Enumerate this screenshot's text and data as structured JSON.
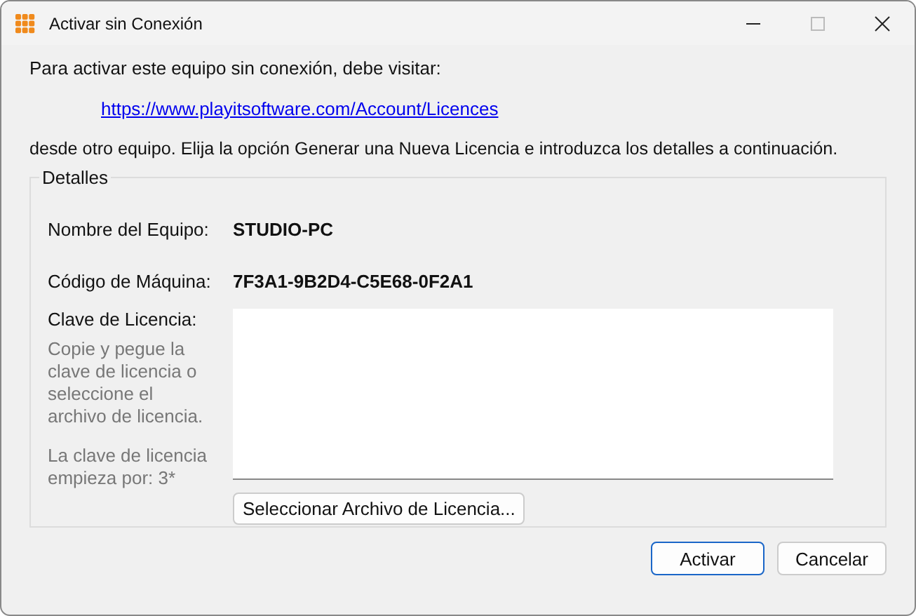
{
  "window": {
    "title": "Activar sin Conexión",
    "maximize_disabled": true
  },
  "intro": "Para activar este equipo sin conexión, debe visitar:",
  "link": "https://www.playitsoftware.com/Account/Licences",
  "instructions": "desde otro equipo. Elija la opción Generar una Nueva Licencia e introduzca los detalles a continuación.",
  "details": {
    "title": "Detalles",
    "fields": [
      {
        "label": "Nombre del Equipo:",
        "value": "STUDIO-PC"
      },
      {
        "label": "Código de Máquina:",
        "value": "7F3A1-9B2D4-C5E68-0F2A1"
      }
    ],
    "license_label": "Clave de Licencia:",
    "hint": "Copie y pegue la clave de licencia o seleccione el archivo de licencia.",
    "prefix_hint": "La clave de licencia empieza por: 3*",
    "select_button": "Seleccionar Archivo de Licencia..."
  },
  "buttons": [
    {
      "label": "Activar",
      "default": true
    },
    {
      "label": "Cancelar",
      "default": false
    }
  ]
}
